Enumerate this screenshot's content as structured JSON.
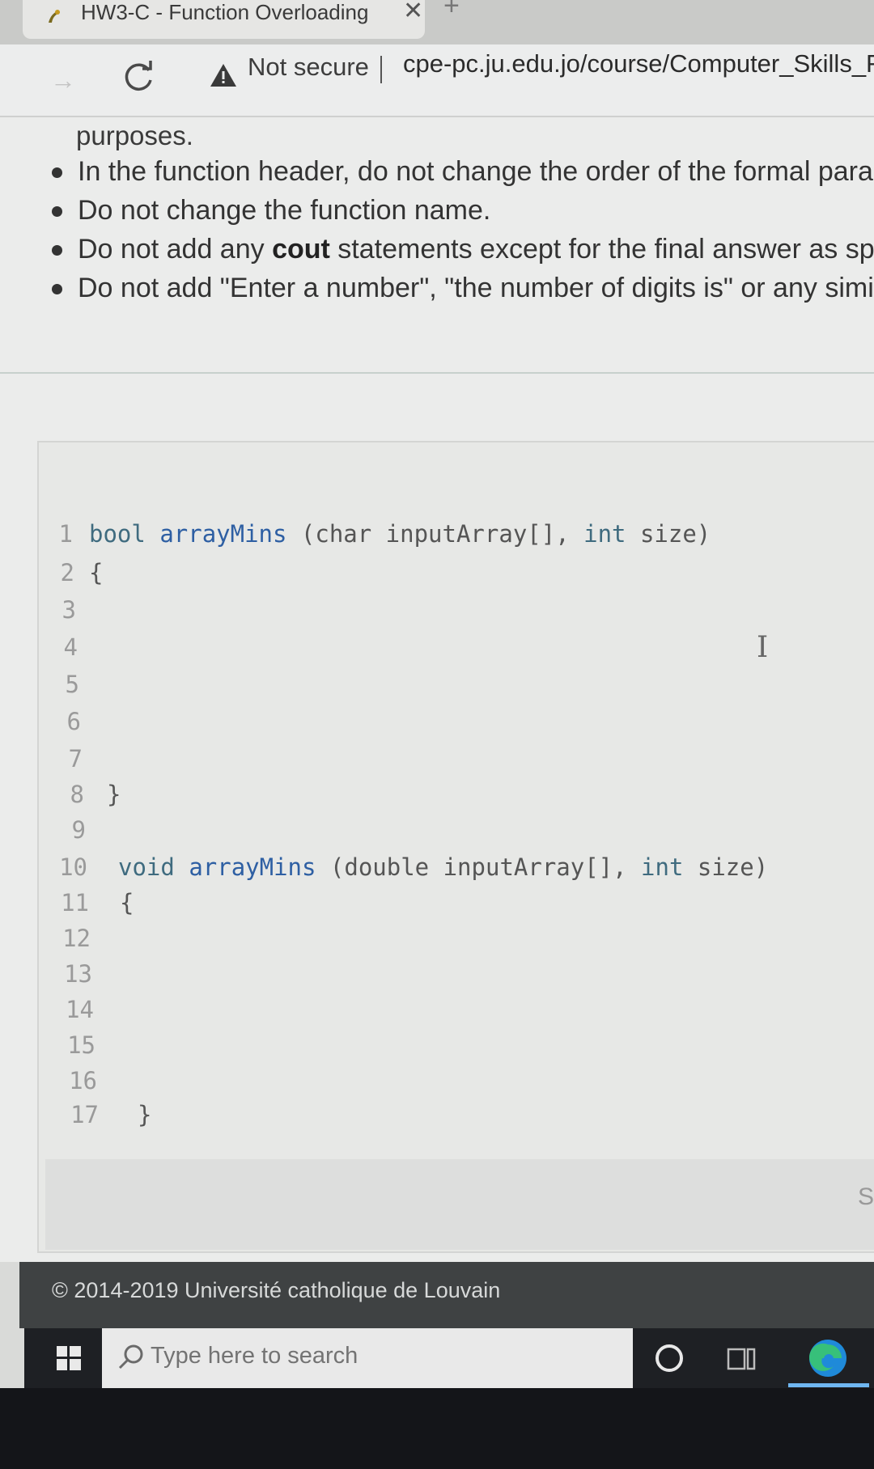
{
  "browser": {
    "tab_title": "HW3-C - Function Overloading",
    "tab_close": "✕",
    "new_tab": "+",
    "security_label": "Not secure",
    "url": "cpe-pc.ju.edu.jo/course/Computer_Skills_For"
  },
  "instructions": {
    "continuation": "purposes.",
    "bullets": [
      {
        "pre": "In the function header, do not change the order of the formal paran",
        "bold": "",
        "post": ""
      },
      {
        "pre": "Do not change the function name.",
        "bold": "",
        "post": ""
      },
      {
        "pre": "Do not add any ",
        "bold": "cout",
        "post": " statements except for the final answer as spec"
      },
      {
        "pre": "Do not add \"Enter a number\", \"the number of digits is\" or any simila",
        "bold": "",
        "post": ""
      }
    ]
  },
  "editor": {
    "lines": [
      {
        "n": "1",
        "ret": "bool",
        "name": "arrayMins",
        "p1": " (char",
        "p2": " inputArray[],",
        "p3": " int",
        "p4": " size)"
      },
      {
        "n": "2",
        "text": "{"
      },
      {
        "n": "3",
        "text": ""
      },
      {
        "n": "4",
        "text": ""
      },
      {
        "n": "5",
        "text": ""
      },
      {
        "n": "6",
        "text": ""
      },
      {
        "n": "7",
        "text": ""
      },
      {
        "n": "8",
        "text": "}"
      },
      {
        "n": "9",
        "text": ""
      },
      {
        "n": "10",
        "ret": "void",
        "name": "arrayMins",
        "p1": " (double",
        "p2": " inputArray[],",
        "p3": " int",
        "p4": " size)"
      },
      {
        "n": "11",
        "text": "{"
      },
      {
        "n": "12",
        "text": ""
      },
      {
        "n": "13",
        "text": ""
      },
      {
        "n": "14",
        "text": ""
      },
      {
        "n": "15",
        "text": ""
      },
      {
        "n": "16",
        "text": ""
      },
      {
        "n": "17",
        "text": "}"
      }
    ],
    "text_cursor": "I"
  },
  "footer": {
    "copyright": "© 2014-2019 Université catholique de Louvain"
  },
  "taskbar": {
    "search_placeholder": "Type here to search"
  },
  "colors": {
    "keyword": "#3f6b7f",
    "function_name": "#2e5fa3",
    "footer_bg": "#3f4243",
    "taskbar_bg": "#1e2024"
  }
}
